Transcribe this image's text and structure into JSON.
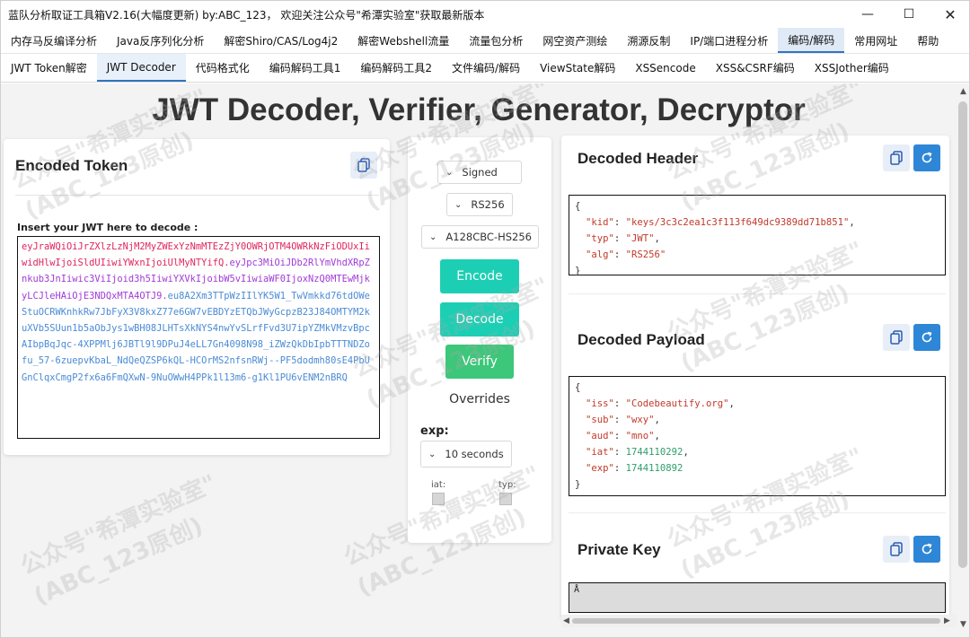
{
  "window": {
    "title": "蓝队分析取证工具箱V2.16(大幅度更新) by:ABC_123， 欢迎关注公众号\"希潭实验室\"获取最新版本",
    "minimize_glyph": "—",
    "maximize_glyph": "☐",
    "close_glyph": "✕"
  },
  "menu": {
    "items": [
      "内存马反编译分析",
      "Java反序列化分析",
      "解密Shiro/CAS/Log4j2",
      "解密Webshell流量",
      "流量包分析",
      "网空资产测绘",
      "溯源反制",
      "IP/端口进程分析",
      "编码/解码",
      "常用网址",
      "帮助"
    ],
    "active_index": 8
  },
  "subtabs": {
    "items": [
      "JWT Token解密",
      "JWT Decoder",
      "代码格式化",
      "编码解码工具1",
      "编码解码工具2",
      "文件编码/解码",
      "ViewState解码",
      "XSSencode",
      "XSS&CSRF编码",
      "XSSJother编码"
    ],
    "active_index": 1
  },
  "page": {
    "title": "JWT Decoder, Verifier, Generator, Decryptor"
  },
  "encoded": {
    "title": "Encoded Token",
    "insert_label": "Insert your JWT here to decode :",
    "token_header": "eyJraWQiOiJrZXlzLzNjM2MyZWExYzNmMTEzZjY0OWRjOTM4OWRkNzFiODUxIiwidHlwIjoiSldUIiwiYWxnIjoiUlMyNTYifQ.",
    "token_payload": "eyJpc3MiOiJDb2RlYmVhdXRpZnkub3JnIiwic3ViIjoid3h5IiwiYXVkIjoibW5vIiwiaWF0IjoxNzQ0MTEwMjkyLCJleHAiOjE3NDQxMTA4OTJ9.",
    "token_signature": "eu8A2Xm3TTpWzIIlYK5W1_TwVmkkd76tdOWeStuOCRWKnhkRw7JbFyX3V8kxZ77e6GW7vEBDYzETQbJWyGcpzB23J84OMTYM2kuXVb5SUun1b5aObJys1wBH08JLHTsXkNYS4nwYvSLrfFvd3U7ipYZMkVMzvBpcAIbpBqJqc-4XPPMlj6JBTl9l9DPuJ4eLL7Gn4098N98_iZWzQkDbIpbTTTNDZofu_57-6zuepvKbaL_NdQeQZSP6kQL-HCOrMS2nfsnRWj--PF5dodmh80sE4PbUGnClqxCmgP2fx6a6FmQXwN-9NuOWwH4PPk1l13m6-g1Kl1PU6vENM2nBRQ"
  },
  "middle": {
    "select_mode": "Signed",
    "select_alg": "RS256",
    "select_enc": "A128CBC-HS256",
    "encode_label": "Encode",
    "decode_label": "Decode",
    "verify_label": "Verify",
    "overrides_label": "Overrides",
    "exp_label": "exp:",
    "exp_select": "10 seconds",
    "iat_label": "iat:",
    "typ_label": "typ:"
  },
  "header": {
    "title": "Decoded Header",
    "open_brace": "{",
    "close_brace": "}",
    "kid_key": "\"kid\"",
    "kid_val": "\"keys/3c3c2ea1c3f113f649dc9389dd71b851\"",
    "typ_key": "\"typ\"",
    "typ_val": "\"JWT\"",
    "alg_key": "\"alg\"",
    "alg_val": "\"RS256\""
  },
  "payload": {
    "title": "Decoded Payload",
    "open_brace": "{",
    "close_brace": "}",
    "iss_key": "\"iss\"",
    "iss_val": "\"Codebeautify.org\"",
    "sub_key": "\"sub\"",
    "sub_val": "\"wxy\"",
    "aud_key": "\"aud\"",
    "aud_val": "\"mno\"",
    "iat_key": "\"iat\"",
    "iat_val": "1744110292",
    "exp_key": "\"exp\"",
    "exp_val": "1744110892"
  },
  "private_key": {
    "title": "Private Key",
    "value": "Å"
  },
  "watermark": {
    "line1": "公众号\"希潭实验室\"",
    "line2": "(ABC_123原创)"
  },
  "colors": {
    "accent": "#2f74c0",
    "teal": "#1ccfb4",
    "green": "#3cc77a",
    "icon_blue": "#2e86d6"
  }
}
